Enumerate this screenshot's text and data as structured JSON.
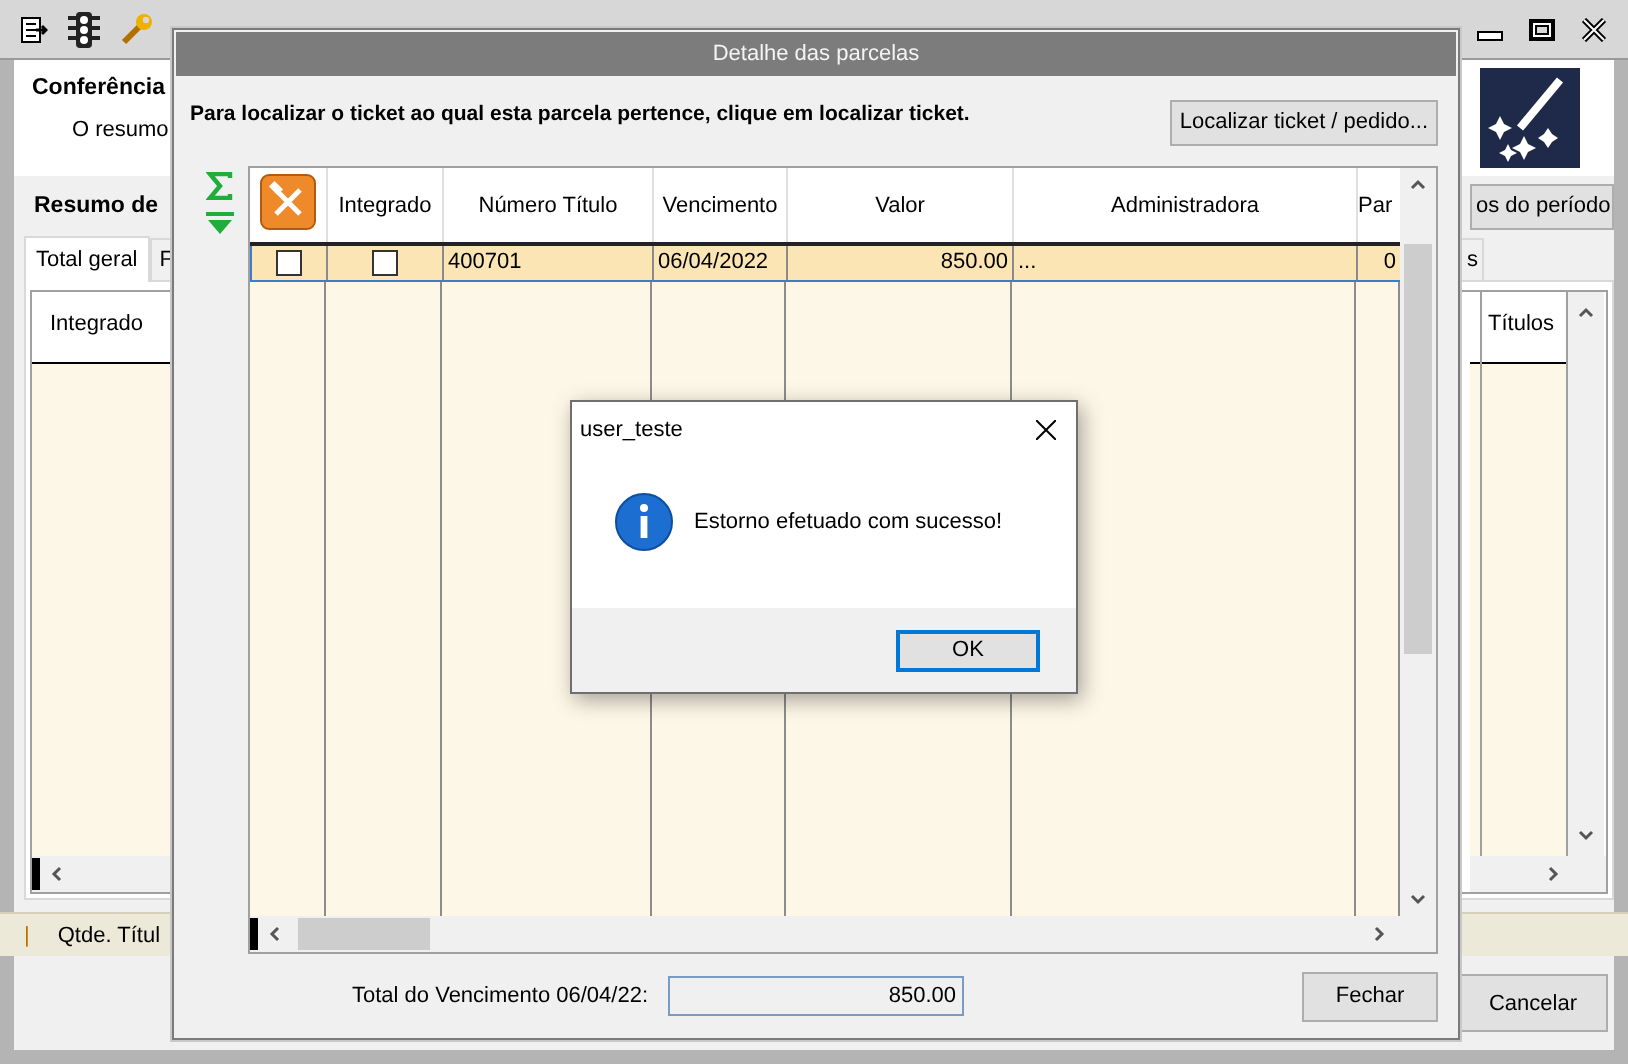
{
  "main_window": {
    "header": {
      "title": "Conferência",
      "subtitle": "O resumo"
    },
    "section_title": "Resumo de",
    "period_button": "os do período",
    "tabs": [
      {
        "label": "Total geral",
        "selected": true
      },
      {
        "label": "F",
        "selected": false
      },
      {
        "label": "s",
        "selected": false
      }
    ],
    "grid": {
      "columns": [
        "Integrado",
        "Títulos"
      ]
    },
    "status_separator": "|",
    "status_bar": "Qtde. Títul",
    "cancel_button": "Cancelar"
  },
  "dialog": {
    "title": "Detalhe das parcelas",
    "instruction": "Para localizar o ticket ao qual esta parcela pertence, clique em localizar ticket.",
    "locate_button": "Localizar ticket / pedido...",
    "table": {
      "columns": [
        "Integrado",
        "Número Título",
        "Vencimento",
        "Valor",
        "Administradora",
        "Par"
      ],
      "rows": [
        {
          "selected": true,
          "checked": false,
          "integrado": false,
          "numero_titulo": "400701",
          "vencimento": "06/04/2022",
          "valor": "850.00",
          "administradora": "...",
          "column_7": "0"
        }
      ]
    },
    "total_label": "Total do Vencimento 06/04/22:",
    "total_value": "850.00",
    "close_button": "Fechar"
  },
  "message_box": {
    "title": "user_teste",
    "message": "Estorno efetuado com sucesso!",
    "ok_button": "OK"
  }
}
